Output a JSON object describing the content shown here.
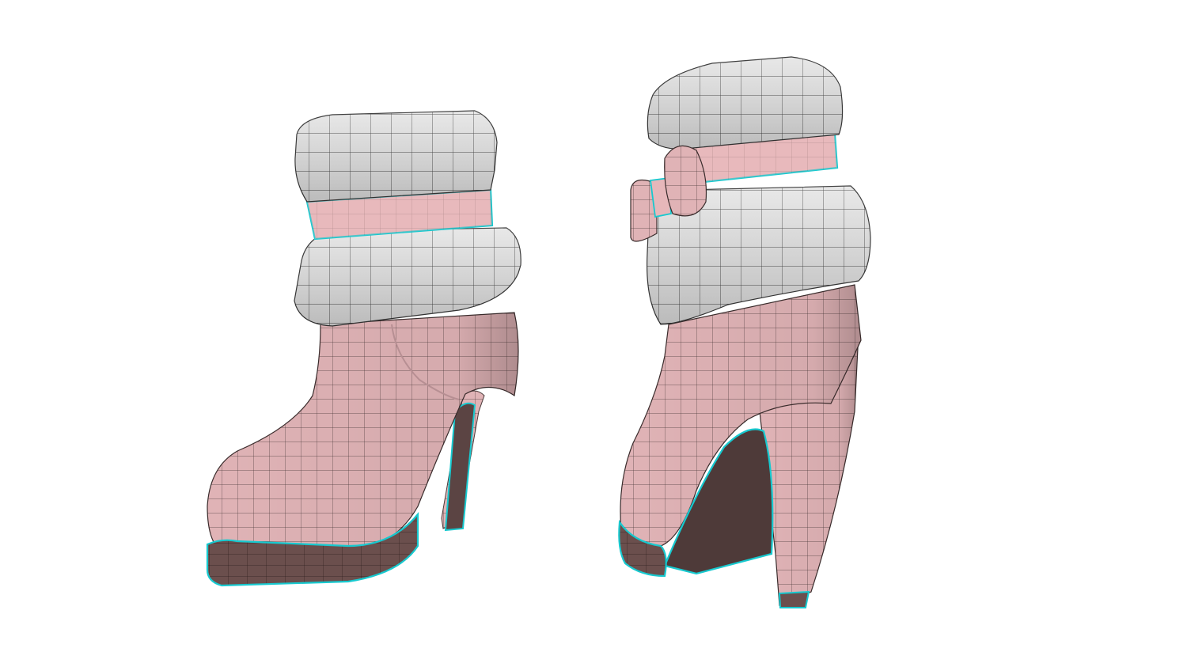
{
  "scene": {
    "subject_count": 2,
    "colors": {
      "background": "#ffffff",
      "boot_pink": "#e2b5b8",
      "boot_pink_shade": "#c9969b",
      "fur_white": "#e6e6e6",
      "fur_shade": "#b9b9b9",
      "band_pink": "#ecbcbf",
      "sole_brown": "#6b4f4d",
      "sole_dark": "#4a3433",
      "edge_highlight": "#17c9cf",
      "wire_line": "#2a2a2a"
    }
  }
}
